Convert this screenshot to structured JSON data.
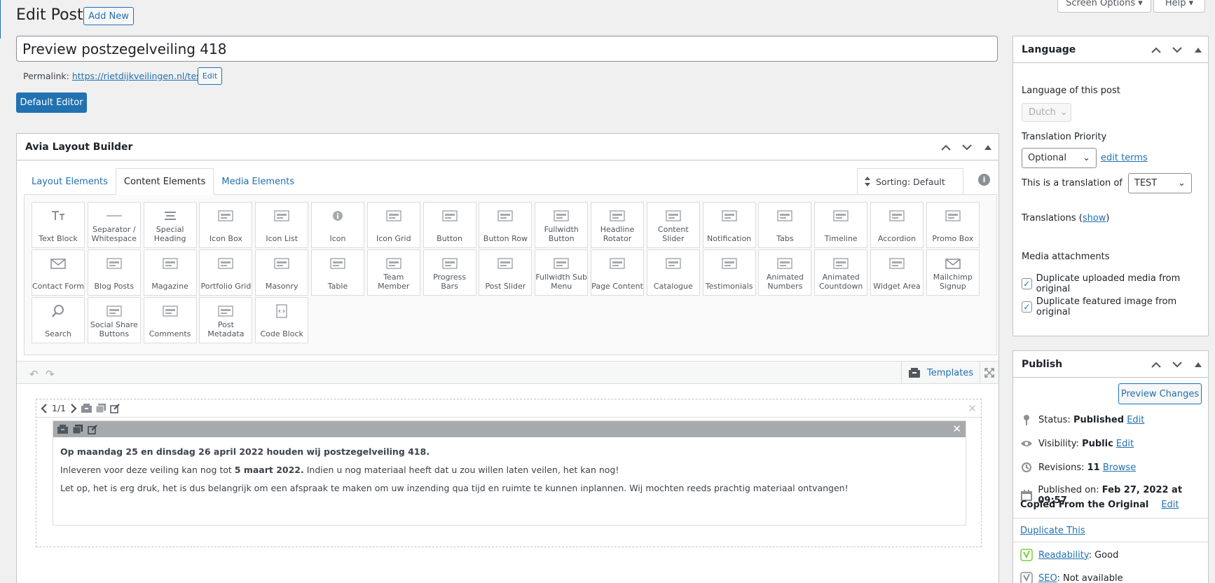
{
  "header": {
    "title": "Edit Post",
    "add_new": "Add New",
    "screen_options": "Screen Options",
    "help": "Help"
  },
  "post": {
    "title": "Preview postzegelveiling 418",
    "permalink_label": "Permalink:",
    "permalink_url": "https://rietdijkveilingen.nl/test/",
    "permalink_edit": "Edit",
    "default_editor": "Default Editor"
  },
  "avia": {
    "title": "Avia Layout Builder",
    "tabs": [
      {
        "label": "Layout Elements"
      },
      {
        "label": "Content Elements"
      },
      {
        "label": "Media Elements"
      }
    ],
    "sorting": "Sorting: Default",
    "info": "i",
    "elements": [
      {
        "label": "Text Block",
        "icon": "text-block-icon"
      },
      {
        "label": "Separator / Whitespace",
        "icon": "separator-icon"
      },
      {
        "label": "Special Heading",
        "icon": "heading-icon"
      },
      {
        "label": "Icon Box",
        "icon": "icon-box-icon"
      },
      {
        "label": "Icon List",
        "icon": "icon-list-icon"
      },
      {
        "label": "Icon",
        "icon": "info-icon"
      },
      {
        "label": "Icon Grid",
        "icon": "grid-icon"
      },
      {
        "label": "Button",
        "icon": "button-icon"
      },
      {
        "label": "Button Row",
        "icon": "button-row-icon"
      },
      {
        "label": "Fullwidth Button",
        "icon": "fullwidth-button-icon"
      },
      {
        "label": "Headline Rotator",
        "icon": "headline-icon"
      },
      {
        "label": "Content Slider",
        "icon": "slider-icon"
      },
      {
        "label": "Notification",
        "icon": "notification-icon"
      },
      {
        "label": "Tabs",
        "icon": "tabs-icon"
      },
      {
        "label": "Timeline",
        "icon": "timeline-icon"
      },
      {
        "label": "Accordion",
        "icon": "accordion-icon"
      },
      {
        "label": "Promo Box",
        "icon": "promo-box-icon"
      },
      {
        "label": "Contact Form",
        "icon": "envelope-icon"
      },
      {
        "label": "Blog Posts",
        "icon": "blog-icon"
      },
      {
        "label": "Magazine",
        "icon": "magazine-icon"
      },
      {
        "label": "Portfolio Grid",
        "icon": "portfolio-grid-icon"
      },
      {
        "label": "Masonry",
        "icon": "masonry-icon"
      },
      {
        "label": "Table",
        "icon": "table-icon"
      },
      {
        "label": "Team Member",
        "icon": "team-icon"
      },
      {
        "label": "Progress Bars",
        "icon": "progress-icon"
      },
      {
        "label": "Post Slider",
        "icon": "post-slider-icon"
      },
      {
        "label": "Fullwidth Sub Menu",
        "icon": "submenu-icon"
      },
      {
        "label": "Page Content",
        "icon": "page-icon"
      },
      {
        "label": "Catalogue",
        "icon": "catalogue-icon"
      },
      {
        "label": "Testimonials",
        "icon": "testimonials-icon"
      },
      {
        "label": "Animated Numbers",
        "icon": "numbers-icon"
      },
      {
        "label": "Animated Countdown",
        "icon": "countdown-icon"
      },
      {
        "label": "Widget Area",
        "icon": "widget-icon"
      },
      {
        "label": "Mailchimp Signup",
        "icon": "mail-icon"
      },
      {
        "label": "Search",
        "icon": "search-icon"
      },
      {
        "label": "Social Share Buttons",
        "icon": "share-icon"
      },
      {
        "label": "Comments",
        "icon": "comments-icon"
      },
      {
        "label": "Post Metadata",
        "icon": "metadata-icon"
      },
      {
        "label": "Code Block",
        "icon": "code-icon"
      }
    ],
    "templates": "Templates",
    "section_counter": "1/1",
    "content": {
      "p1": "Op maandag 25 en dinsdag 26 april 2022 houden wij postzegelveiling 418.",
      "p2a": "Inleveren voor deze veiling kan nog tot ",
      "p2b": "5 maart 2022.",
      "p2c": " Indien u nog materiaal heeft dat u zou willen laten veilen, het kan nog!",
      "p3": "Let op, het is erg druk, het is dus belangrijk om een afspraak te maken om uw inzending qua tijd en ruimte te kunnen inplannen. Wij mochten reeds prachtig materiaal ontvangen!"
    }
  },
  "language": {
    "title": "Language",
    "lang_label": "Language of this post",
    "lang_value": "Dutch",
    "priority_label": "Translation Priority",
    "priority_value": "Optional",
    "edit_terms": "edit terms",
    "translation_of_label": "This is a translation of",
    "translation_of_value": "TEST",
    "translations_label": "Translations (",
    "translations_show": "show",
    "translations_close": ")",
    "media_label": "Media attachments",
    "dup_media": "Duplicate uploaded media from original",
    "dup_featured": "Duplicate featured image from original"
  },
  "publish": {
    "title": "Publish",
    "preview": "Preview Changes",
    "status_label": "Status: ",
    "status_value": "Published",
    "visibility_label": "Visibility: ",
    "visibility_value": "Public",
    "revisions_label": "Revisions: ",
    "revisions_value": "11",
    "browse": "Browse",
    "published_on_label": "Published on: ",
    "published_on_value": "Feb 27, 2022 at 09:57",
    "copied_from": "Copied From the Original",
    "edit": "Edit",
    "duplicate": "Duplicate This",
    "readability_label": "Readability",
    "readability_value": ": Good",
    "seo_label": "SEO",
    "seo_value": ": Not available"
  }
}
